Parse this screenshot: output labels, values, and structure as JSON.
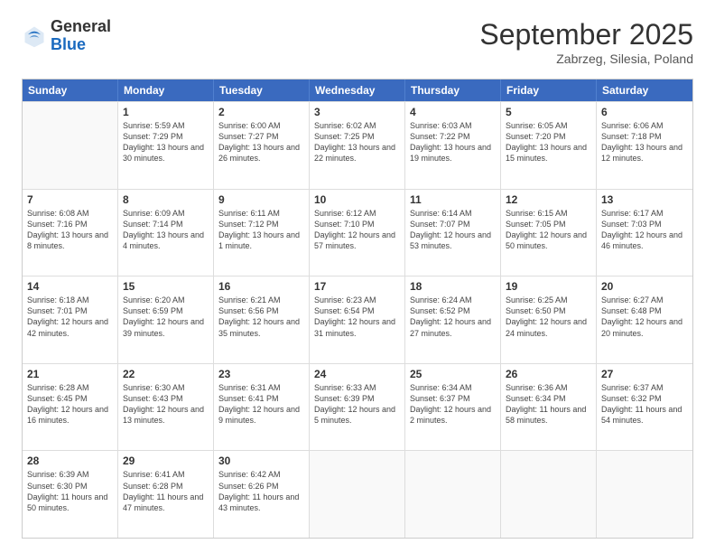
{
  "header": {
    "logo": {
      "general": "General",
      "blue": "Blue"
    },
    "title": "September 2025",
    "subtitle": "Zabrzeg, Silesia, Poland"
  },
  "calendar": {
    "weekdays": [
      "Sunday",
      "Monday",
      "Tuesday",
      "Wednesday",
      "Thursday",
      "Friday",
      "Saturday"
    ],
    "rows": [
      [
        {
          "day": "",
          "sunrise": "",
          "sunset": "",
          "daylight": "",
          "empty": true
        },
        {
          "day": "1",
          "sunrise": "Sunrise: 5:59 AM",
          "sunset": "Sunset: 7:29 PM",
          "daylight": "Daylight: 13 hours and 30 minutes."
        },
        {
          "day": "2",
          "sunrise": "Sunrise: 6:00 AM",
          "sunset": "Sunset: 7:27 PM",
          "daylight": "Daylight: 13 hours and 26 minutes."
        },
        {
          "day": "3",
          "sunrise": "Sunrise: 6:02 AM",
          "sunset": "Sunset: 7:25 PM",
          "daylight": "Daylight: 13 hours and 22 minutes."
        },
        {
          "day": "4",
          "sunrise": "Sunrise: 6:03 AM",
          "sunset": "Sunset: 7:22 PM",
          "daylight": "Daylight: 13 hours and 19 minutes."
        },
        {
          "day": "5",
          "sunrise": "Sunrise: 6:05 AM",
          "sunset": "Sunset: 7:20 PM",
          "daylight": "Daylight: 13 hours and 15 minutes."
        },
        {
          "day": "6",
          "sunrise": "Sunrise: 6:06 AM",
          "sunset": "Sunset: 7:18 PM",
          "daylight": "Daylight: 13 hours and 12 minutes."
        }
      ],
      [
        {
          "day": "7",
          "sunrise": "Sunrise: 6:08 AM",
          "sunset": "Sunset: 7:16 PM",
          "daylight": "Daylight: 13 hours and 8 minutes."
        },
        {
          "day": "8",
          "sunrise": "Sunrise: 6:09 AM",
          "sunset": "Sunset: 7:14 PM",
          "daylight": "Daylight: 13 hours and 4 minutes."
        },
        {
          "day": "9",
          "sunrise": "Sunrise: 6:11 AM",
          "sunset": "Sunset: 7:12 PM",
          "daylight": "Daylight: 13 hours and 1 minute."
        },
        {
          "day": "10",
          "sunrise": "Sunrise: 6:12 AM",
          "sunset": "Sunset: 7:10 PM",
          "daylight": "Daylight: 12 hours and 57 minutes."
        },
        {
          "day": "11",
          "sunrise": "Sunrise: 6:14 AM",
          "sunset": "Sunset: 7:07 PM",
          "daylight": "Daylight: 12 hours and 53 minutes."
        },
        {
          "day": "12",
          "sunrise": "Sunrise: 6:15 AM",
          "sunset": "Sunset: 7:05 PM",
          "daylight": "Daylight: 12 hours and 50 minutes."
        },
        {
          "day": "13",
          "sunrise": "Sunrise: 6:17 AM",
          "sunset": "Sunset: 7:03 PM",
          "daylight": "Daylight: 12 hours and 46 minutes."
        }
      ],
      [
        {
          "day": "14",
          "sunrise": "Sunrise: 6:18 AM",
          "sunset": "Sunset: 7:01 PM",
          "daylight": "Daylight: 12 hours and 42 minutes."
        },
        {
          "day": "15",
          "sunrise": "Sunrise: 6:20 AM",
          "sunset": "Sunset: 6:59 PM",
          "daylight": "Daylight: 12 hours and 39 minutes."
        },
        {
          "day": "16",
          "sunrise": "Sunrise: 6:21 AM",
          "sunset": "Sunset: 6:56 PM",
          "daylight": "Daylight: 12 hours and 35 minutes."
        },
        {
          "day": "17",
          "sunrise": "Sunrise: 6:23 AM",
          "sunset": "Sunset: 6:54 PM",
          "daylight": "Daylight: 12 hours and 31 minutes."
        },
        {
          "day": "18",
          "sunrise": "Sunrise: 6:24 AM",
          "sunset": "Sunset: 6:52 PM",
          "daylight": "Daylight: 12 hours and 27 minutes."
        },
        {
          "day": "19",
          "sunrise": "Sunrise: 6:25 AM",
          "sunset": "Sunset: 6:50 PM",
          "daylight": "Daylight: 12 hours and 24 minutes."
        },
        {
          "day": "20",
          "sunrise": "Sunrise: 6:27 AM",
          "sunset": "Sunset: 6:48 PM",
          "daylight": "Daylight: 12 hours and 20 minutes."
        }
      ],
      [
        {
          "day": "21",
          "sunrise": "Sunrise: 6:28 AM",
          "sunset": "Sunset: 6:45 PM",
          "daylight": "Daylight: 12 hours and 16 minutes."
        },
        {
          "day": "22",
          "sunrise": "Sunrise: 6:30 AM",
          "sunset": "Sunset: 6:43 PM",
          "daylight": "Daylight: 12 hours and 13 minutes."
        },
        {
          "day": "23",
          "sunrise": "Sunrise: 6:31 AM",
          "sunset": "Sunset: 6:41 PM",
          "daylight": "Daylight: 12 hours and 9 minutes."
        },
        {
          "day": "24",
          "sunrise": "Sunrise: 6:33 AM",
          "sunset": "Sunset: 6:39 PM",
          "daylight": "Daylight: 12 hours and 5 minutes."
        },
        {
          "day": "25",
          "sunrise": "Sunrise: 6:34 AM",
          "sunset": "Sunset: 6:37 PM",
          "daylight": "Daylight: 12 hours and 2 minutes."
        },
        {
          "day": "26",
          "sunrise": "Sunrise: 6:36 AM",
          "sunset": "Sunset: 6:34 PM",
          "daylight": "Daylight: 11 hours and 58 minutes."
        },
        {
          "day": "27",
          "sunrise": "Sunrise: 6:37 AM",
          "sunset": "Sunset: 6:32 PM",
          "daylight": "Daylight: 11 hours and 54 minutes."
        }
      ],
      [
        {
          "day": "28",
          "sunrise": "Sunrise: 6:39 AM",
          "sunset": "Sunset: 6:30 PM",
          "daylight": "Daylight: 11 hours and 50 minutes."
        },
        {
          "day": "29",
          "sunrise": "Sunrise: 6:41 AM",
          "sunset": "Sunset: 6:28 PM",
          "daylight": "Daylight: 11 hours and 47 minutes."
        },
        {
          "day": "30",
          "sunrise": "Sunrise: 6:42 AM",
          "sunset": "Sunset: 6:26 PM",
          "daylight": "Daylight: 11 hours and 43 minutes."
        },
        {
          "day": "",
          "sunrise": "",
          "sunset": "",
          "daylight": "",
          "empty": true
        },
        {
          "day": "",
          "sunrise": "",
          "sunset": "",
          "daylight": "",
          "empty": true
        },
        {
          "day": "",
          "sunrise": "",
          "sunset": "",
          "daylight": "",
          "empty": true
        },
        {
          "day": "",
          "sunrise": "",
          "sunset": "",
          "daylight": "",
          "empty": true
        }
      ]
    ]
  }
}
